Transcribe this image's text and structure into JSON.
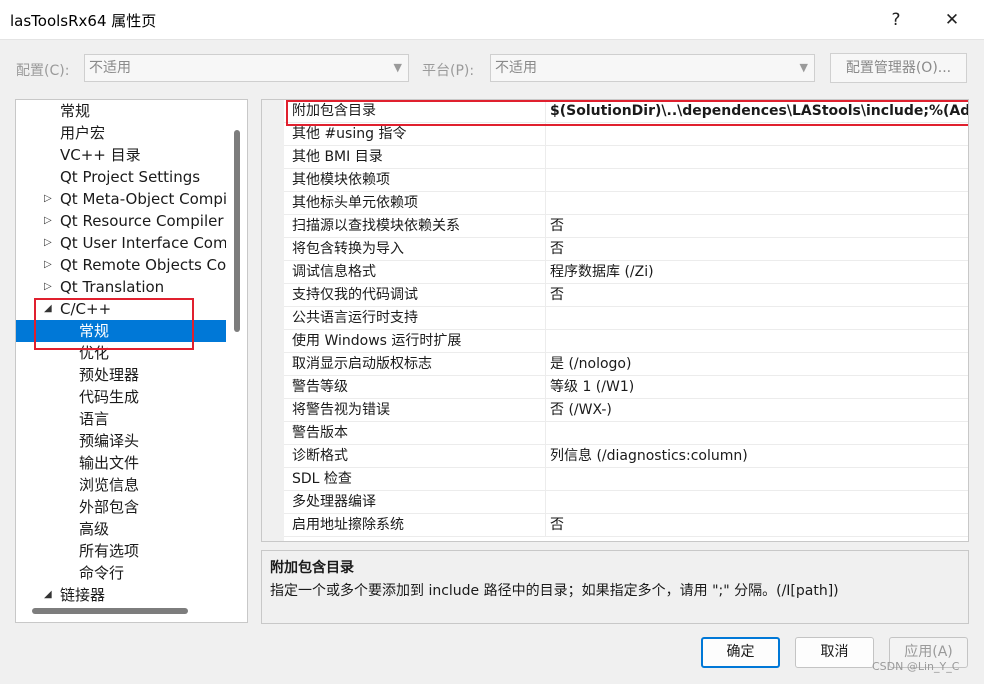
{
  "window": {
    "title": "lasToolsRx64 属性页",
    "help": "?",
    "close": "✕"
  },
  "config": {
    "config_label": "配置(C):",
    "config_value": "不适用",
    "platform_label": "平台(P):",
    "platform_value": "不适用",
    "manager_label": "配置管理器(O)..."
  },
  "tree": {
    "items": [
      {
        "label": "常规"
      },
      {
        "label": "用户宏"
      },
      {
        "label": "VC++ 目录"
      },
      {
        "label": "Qt Project Settings"
      },
      {
        "label": "Qt Meta-Object Compiler"
      },
      {
        "label": "Qt Resource Compiler"
      },
      {
        "label": "Qt User Interface Compiler"
      },
      {
        "label": "Qt Remote Objects Compiler"
      },
      {
        "label": "Qt Translation"
      },
      {
        "label": "C/C++"
      },
      {
        "label": "常规"
      },
      {
        "label": "优化"
      },
      {
        "label": "预处理器"
      },
      {
        "label": "代码生成"
      },
      {
        "label": "语言"
      },
      {
        "label": "预编译头"
      },
      {
        "label": "输出文件"
      },
      {
        "label": "浏览信息"
      },
      {
        "label": "外部包含"
      },
      {
        "label": "高级"
      },
      {
        "label": "所有选项"
      },
      {
        "label": "命令行"
      },
      {
        "label": "链接器"
      }
    ],
    "collapsed_glyph": "▷",
    "expanded_glyph": "◢"
  },
  "properties": {
    "rows": [
      {
        "name": "附加包含目录",
        "value": "$(SolutionDir)\\..\\dependences\\LAStools\\include;%(AdditionalIncludeDirectories)"
      },
      {
        "name": "其他 #using 指令",
        "value": ""
      },
      {
        "name": "其他 BMI 目录",
        "value": ""
      },
      {
        "name": "其他模块依赖项",
        "value": ""
      },
      {
        "name": "其他标头单元依赖项",
        "value": ""
      },
      {
        "name": "扫描源以查找模块依赖关系",
        "value": "否"
      },
      {
        "name": "将包含转换为导入",
        "value": "否"
      },
      {
        "name": "调试信息格式",
        "value": "程序数据库 (/Zi)"
      },
      {
        "name": "支持仅我的代码调试",
        "value": "否"
      },
      {
        "name": "公共语言运行时支持",
        "value": ""
      },
      {
        "name": "使用 Windows 运行时扩展",
        "value": ""
      },
      {
        "name": "取消显示启动版权标志",
        "value": "是 (/nologo)"
      },
      {
        "name": "警告等级",
        "value": "等级 1 (/W1)"
      },
      {
        "name": "将警告视为错误",
        "value": "否 (/WX-)"
      },
      {
        "name": "警告版本",
        "value": ""
      },
      {
        "name": "诊断格式",
        "value": "列信息 (/diagnostics:column)"
      },
      {
        "name": "SDL 检查",
        "value": ""
      },
      {
        "name": "多处理器编译",
        "value": ""
      },
      {
        "name": "启用地址擦除系统",
        "value": "否"
      }
    ]
  },
  "description": {
    "title": "附加包含目录",
    "text": "指定一个或多个要添加到 include 路径中的目录；如果指定多个，请用 \";\" 分隔。(/I[path])"
  },
  "buttons": {
    "ok": "确定",
    "cancel": "取消",
    "apply": "应用(A)"
  },
  "watermark": "CSDN @Lin_Y_C",
  "colors": {
    "selection": "#0078d7",
    "highlight_box": "#e0202e"
  }
}
